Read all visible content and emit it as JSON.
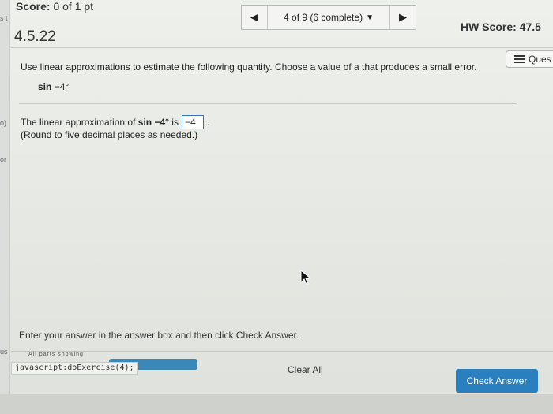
{
  "header": {
    "score_label": "Score:",
    "score_value": "0 of 1 pt",
    "problem_id": "4.5.22",
    "nav_status": "4 of 9 (6 complete)",
    "hw_score": "HW Score: 47.5"
  },
  "question_menu": {
    "label": "Ques"
  },
  "question": {
    "instructions": "Use linear approximations to estimate the following quantity. Choose a value of a that produces a small error.",
    "quantity_func": "sin",
    "quantity_arg": "−4°",
    "answer_prefix": "The linear approximation of",
    "answer_func": "sin",
    "answer_arg": "−4°",
    "answer_is": "is",
    "answer_value": "−4",
    "answer_suffix": ".",
    "round_note": "(Round to five decimal places as needed.)"
  },
  "footer": {
    "instruction_text": "Enter your answer in the answer box and then click Check Answer.",
    "all_parts": "All parts showing",
    "status_url": "javascript:doExercise(4);",
    "clear_all": "Clear All",
    "check_answer": "Check Answer"
  },
  "gutter": {
    "frag_1": "s t",
    "frag_2": "o)",
    "frag_3": "or",
    "frag_4": "us"
  }
}
